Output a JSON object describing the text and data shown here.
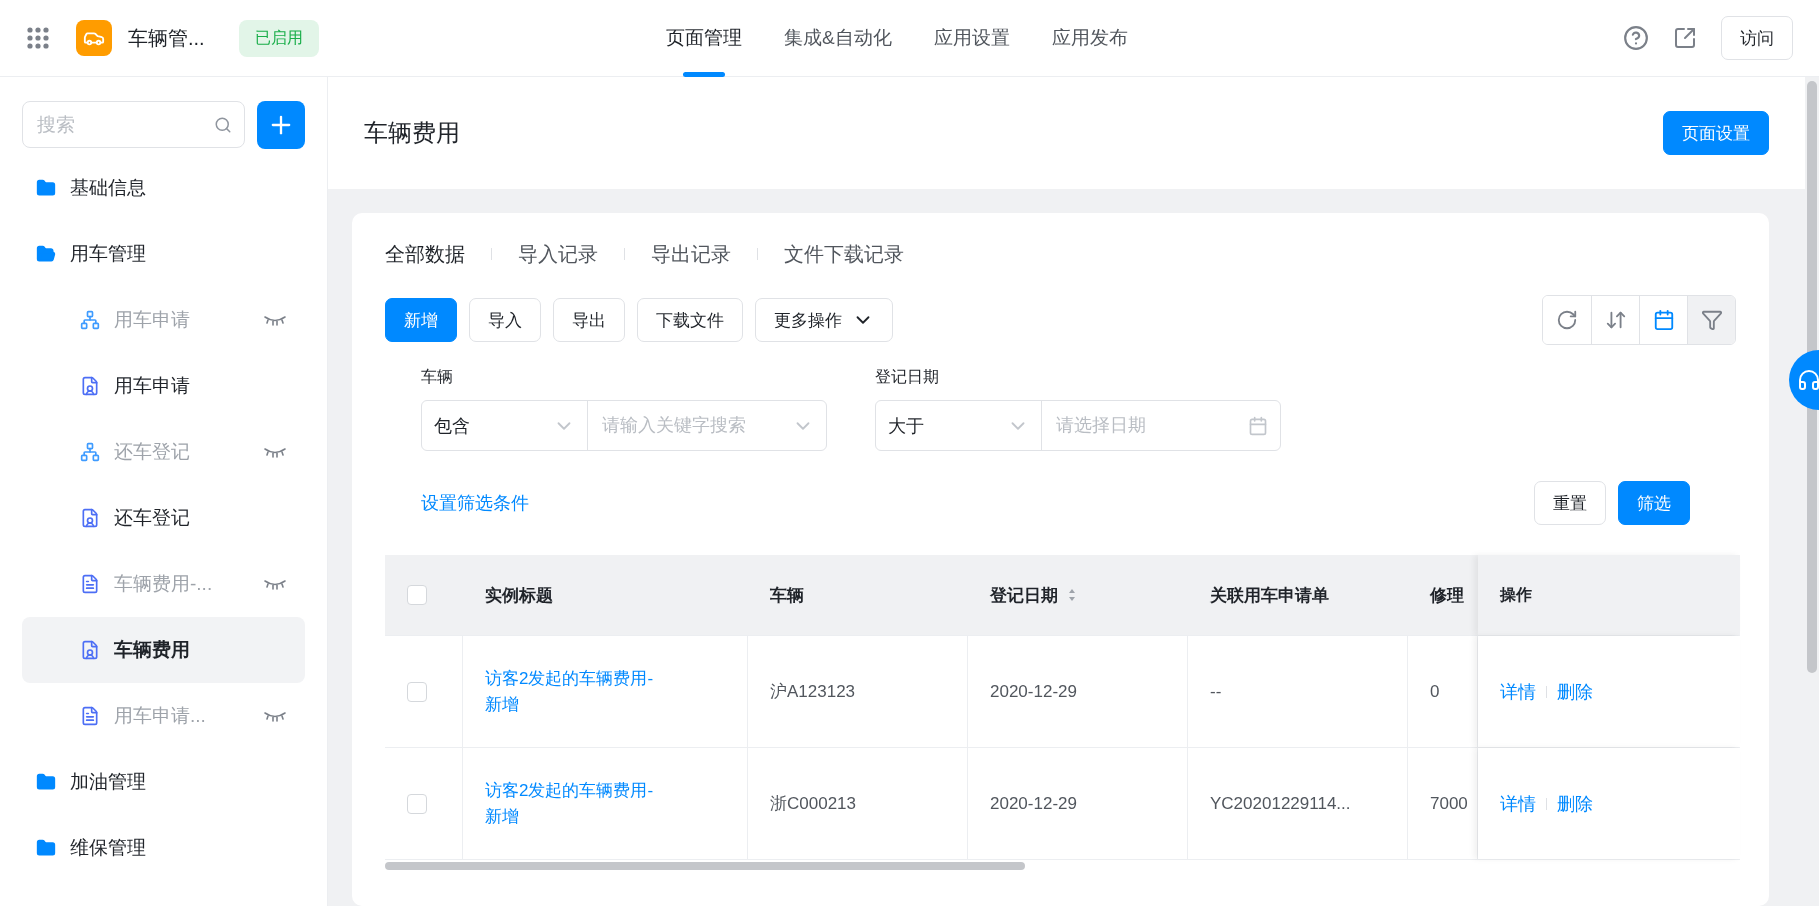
{
  "app": {
    "name": "车辆管...",
    "status": "已启用"
  },
  "nav_tabs": [
    {
      "label": "页面管理",
      "selected": true
    },
    {
      "label": "集成&自动化",
      "selected": false
    },
    {
      "label": "应用设置",
      "selected": false
    },
    {
      "label": "应用发布",
      "selected": false
    }
  ],
  "visit_button": "访问",
  "sidebar": {
    "search": {
      "placeholder": "搜索"
    },
    "items": [
      {
        "kind": "folder",
        "label": "基础信息",
        "expanded": false,
        "hidden": false,
        "selected": false
      },
      {
        "kind": "folder",
        "label": "用车管理",
        "expanded": true,
        "hidden": false,
        "selected": false,
        "children": [
          {
            "kind": "flow",
            "label": "用车申请",
            "hidden": true,
            "selected": false
          },
          {
            "kind": "form",
            "label": "用车申请",
            "hidden": false,
            "selected": false
          },
          {
            "kind": "flow",
            "label": "还车登记",
            "hidden": true,
            "selected": false
          },
          {
            "kind": "form",
            "label": "还车登记",
            "hidden": false,
            "selected": false
          },
          {
            "kind": "doc",
            "label": "车辆费用-...",
            "hidden": true,
            "selected": false
          },
          {
            "kind": "form",
            "label": "车辆费用",
            "hidden": false,
            "selected": true
          },
          {
            "kind": "doc",
            "label": "用车申请...",
            "hidden": true,
            "selected": false
          }
        ]
      },
      {
        "kind": "folder",
        "label": "加油管理",
        "expanded": false,
        "hidden": false,
        "selected": false
      },
      {
        "kind": "folder",
        "label": "维保管理",
        "expanded": false,
        "hidden": false,
        "selected": false
      }
    ]
  },
  "page": {
    "title": "车辆费用",
    "settings_button": "页面设置"
  },
  "data_tabs": [
    {
      "label": "全部数据",
      "selected": true
    },
    {
      "label": "导入记录",
      "selected": false
    },
    {
      "label": "导出记录",
      "selected": false
    },
    {
      "label": "文件下载记录",
      "selected": false
    }
  ],
  "toolbar": [
    {
      "label": "新增",
      "primary": true,
      "dropdown": false
    },
    {
      "label": "导入",
      "primary": false,
      "dropdown": false
    },
    {
      "label": "导出",
      "primary": false,
      "dropdown": false
    },
    {
      "label": "下载文件",
      "primary": false,
      "dropdown": false
    },
    {
      "label": "更多操作",
      "primary": false,
      "dropdown": true
    }
  ],
  "filters": [
    {
      "kind": "select",
      "label": "车辆",
      "operator": "包含",
      "placeholder": "请输入关键字搜索"
    },
    {
      "kind": "date",
      "label": "登记日期",
      "operator": "大于",
      "placeholder": "请选择日期"
    }
  ],
  "filter_link": "设置筛选条件",
  "reset_button": "重置",
  "apply_button": "筛选",
  "table": {
    "all_checked": false,
    "columns": [
      {
        "label": "实例标题",
        "sortable": false
      },
      {
        "label": "车辆",
        "sortable": false
      },
      {
        "label": "登记日期",
        "sortable": true
      },
      {
        "label": "关联用车申请单",
        "sortable": false
      },
      {
        "label": "修理",
        "sortable": false
      }
    ],
    "action_column": "操作",
    "rows": [
      {
        "checked": false,
        "cells": [
          "访客2发起的车辆费用-新增",
          "沪A123123",
          "2020-12-29",
          "--",
          "0"
        ],
        "actions": [
          "详情",
          "删除"
        ]
      },
      {
        "checked": false,
        "cells": [
          "访客2发起的车辆费用-新增",
          "浙C000213",
          "2020-12-29",
          "YC20201229114...",
          "7000"
        ],
        "actions": [
          "详情",
          "删除"
        ]
      }
    ]
  }
}
